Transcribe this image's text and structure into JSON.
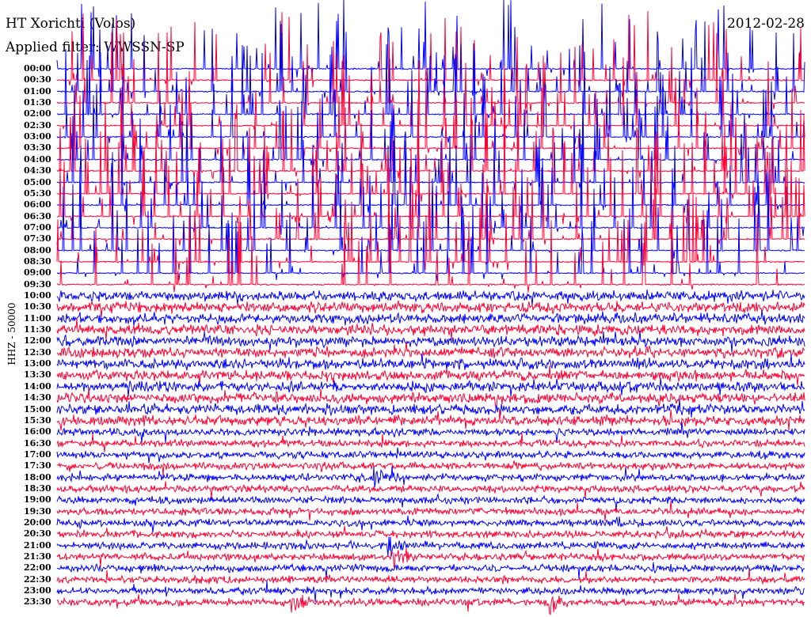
{
  "header": {
    "station": "HT Xorichti (Volos)",
    "filter": "Applied filter: WWSSN-SP",
    "date": "2012-02-28"
  },
  "chart_data": {
    "type": "line",
    "title": "HT Xorichti (Volos)",
    "subtitle": "Applied filter: WWSSN-SP",
    "ylabel": "HHZ - 50000",
    "xlabel": "",
    "colors": [
      "#0000ff",
      "#ff0033"
    ],
    "row_labels": [
      "00:00",
      "00:30",
      "01:00",
      "01:30",
      "02:00",
      "02:30",
      "03:00",
      "03:30",
      "04:00",
      "04:30",
      "05:00",
      "05:30",
      "06:00",
      "06:30",
      "07:00",
      "07:30",
      "08:00",
      "08:30",
      "09:00",
      "09:30",
      "10:00",
      "10:30",
      "11:00",
      "11:30",
      "12:00",
      "12:30",
      "13:00",
      "13:30",
      "14:00",
      "14:30",
      "15:00",
      "15:30",
      "16:00",
      "16:30",
      "17:00",
      "17:30",
      "18:00",
      "18:30",
      "19:00",
      "19:30",
      "20:00",
      "20:30",
      "21:00",
      "21:30",
      "22:00",
      "22:30",
      "23:00",
      "23:30"
    ],
    "minutes_per_row": 30,
    "events": [
      {
        "row": "18:00",
        "minute": 12.8
      },
      {
        "row": "21:00",
        "minute": 13.3
      },
      {
        "row": "21:30",
        "minute": 13.5
      },
      {
        "row": "23:30",
        "minute": 9.5
      },
      {
        "row": "23:30",
        "minute": 19.8
      }
    ]
  }
}
